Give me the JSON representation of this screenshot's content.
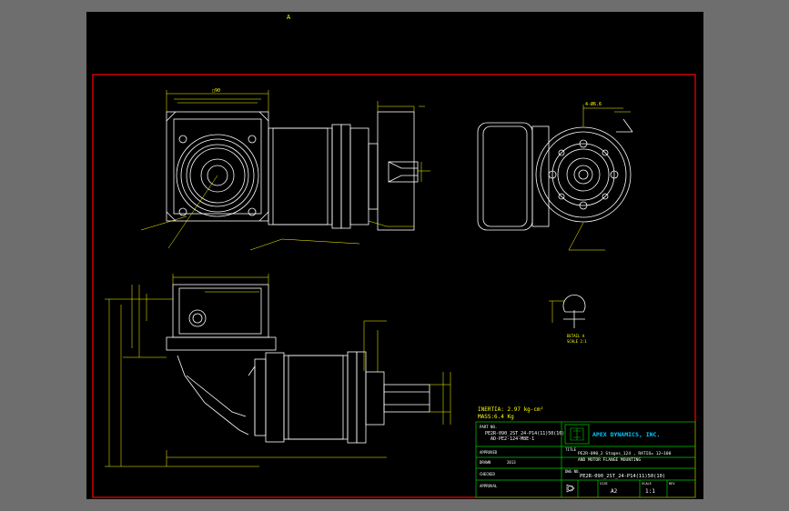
{
  "sheet": {
    "marker_top": "A",
    "background_color": "#000000",
    "frame_color": "#ff0000",
    "line_color": "#ffffff",
    "dim_color": "#ffff00",
    "title_block_color": "#00cc00"
  },
  "views": {
    "front": {
      "dim_top": "□90"
    },
    "side": {
      "dim_top": "4-Ø6.6"
    },
    "detail": {
      "label": "DETAIL A",
      "scale": "SCALE 2:1"
    }
  },
  "properties": {
    "inertia": "INERTIA: 2.97 kg-cm²",
    "mass": "MASS:6.4 Kg"
  },
  "title_block": {
    "part_no_label": "PART NO.",
    "part_no_line1": "PE2R-090_2ST_24-P14(11)50(10)",
    "part_no_line2": "AD-PE2-124-M8E-1",
    "company": "APEX DYNAMICS, INC.",
    "approved_label": "APPROVED",
    "drawn_label": "DRAWN",
    "drawn_value": "2013",
    "checked_label": "CHECKED",
    "approval_label": "APPROVAL",
    "title_label": "TITLE",
    "title_line1": "PE2R-090_2 Stages_124 , RATIO= 12~100",
    "title_line2": "AND MOTOR FLANGE MOUNTING",
    "dwg_label": "DWG NO.",
    "dwg_no": "PE2R-090_2ST_24-P14(11)50(10)",
    "size_label": "SIZE",
    "size_value": "A2",
    "scale_label": "SCALE",
    "scale_value": "1:1",
    "rev_label": "REV"
  }
}
